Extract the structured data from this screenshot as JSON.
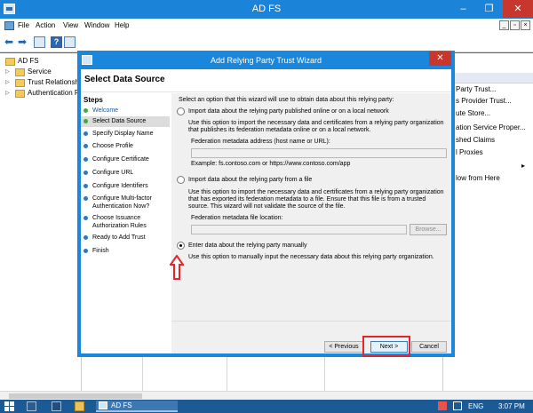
{
  "window": {
    "title": "AD FS",
    "controls": {
      "minimize": "–",
      "maximize": "❐",
      "close": "✕"
    }
  },
  "menu": [
    "File",
    "Action",
    "View",
    "Window",
    "Help"
  ],
  "mdi_controls": [
    "_",
    "▫",
    "×"
  ],
  "tree": {
    "root": "AD FS",
    "items": [
      "Service",
      "Trust Relationship",
      "Authentication Po"
    ]
  },
  "actions": {
    "items": [
      "Party Trust...",
      "s Provider Trust...",
      "ute Store...",
      "ation Service Proper...",
      "shed Claims",
      "l Proxies",
      "low from Here"
    ],
    "arrow": "▸"
  },
  "wizard": {
    "title": "Add Relying Party Trust Wizard",
    "close": "✕",
    "page_title": "Select Data Source",
    "steps_title": "Steps",
    "steps": [
      {
        "label": "Welcome",
        "status": "done"
      },
      {
        "label": "Select Data Source",
        "status": "current"
      },
      {
        "label": "Specify Display Name",
        "status": "pending"
      },
      {
        "label": "Choose Profile",
        "status": "pending"
      },
      {
        "label": "Configure Certificate",
        "status": "pending"
      },
      {
        "label": "Configure URL",
        "status": "pending"
      },
      {
        "label": "Configure Identifiers",
        "status": "pending"
      },
      {
        "label": "Configure Multi-factor Authentication Now?",
        "status": "pending"
      },
      {
        "label": "Choose Issuance Authorization Rules",
        "status": "pending"
      },
      {
        "label": "Ready to Add Trust",
        "status": "pending"
      },
      {
        "label": "Finish",
        "status": "pending"
      }
    ],
    "intro": "Select an option that this wizard will use to obtain data about this relying party:",
    "options": {
      "online": {
        "label": "Import data about the relying party published online or on a local network",
        "desc": "Use this option to import the necessary data and certificates from a relying party organization that publishes its federation metadata online or on a local network.",
        "field_label": "Federation metadata address (host name or URL):",
        "field_value": "",
        "example": "Example: fs.contoso.com or https://www.contoso.com/app",
        "selected": false
      },
      "file": {
        "label": "Import data about the relying party from a file",
        "desc": "Use this option to import the necessary data and certificates from a relying party organization that has exported its federation metadata to a file. Ensure that this file is from a trusted source. This wizard will not validate the source of the file.",
        "field_label": "Federation metadata file location:",
        "field_value": "",
        "browse": "Browse...",
        "selected": false
      },
      "manual": {
        "label": "Enter data about the relying party manually",
        "desc": "Use this option to manually input the necessary data about this relying party organization.",
        "selected": true
      }
    },
    "buttons": {
      "previous": "< Previous",
      "next": "Next >",
      "cancel": "Cancel"
    }
  },
  "taskbar": {
    "task": "AD FS",
    "lang": "ENG",
    "time": "3:07 PM"
  },
  "colors": {
    "accent": "#1c84d8",
    "close_red": "#c7372d",
    "highlight_red": "#e3262b"
  }
}
